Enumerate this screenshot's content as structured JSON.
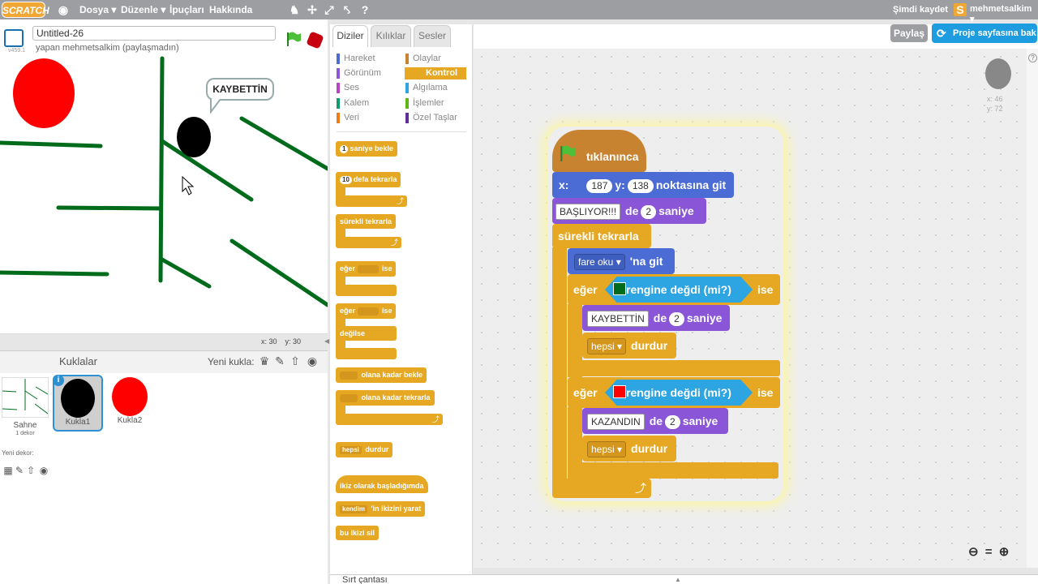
{
  "menu": {
    "logo": "SCRATCH",
    "file": "Dosya ▾",
    "edit": "Düzenle ▾",
    "tips": "İpuçları",
    "about": "Hakkında",
    "save_now": "Şimdi kaydet",
    "username": "mehmetsalkim ▾"
  },
  "header": {
    "project_title": "Untitled-26",
    "author": "yapan mehmetsalkim (paylaşmadın)",
    "version": "v459.1",
    "share_label": "Paylaş",
    "project_page_label": "Proje sayfasına bak"
  },
  "stage": {
    "speech": "KAYBETTİN",
    "x_label": "x: 30",
    "y_label": "y: 30"
  },
  "sprites": {
    "label": "Kuklalar",
    "new_sprite": "Yeni kukla:",
    "stage_label": "Sahne",
    "stage_dekor": "1 dekor",
    "new_dekor": "Yeni dekor:",
    "items": [
      {
        "name": "Kukla1",
        "color": "#000000"
      },
      {
        "name": "Kukla2",
        "color": "#ff0000"
      }
    ]
  },
  "tabs": [
    "Diziler",
    "Kılıklar",
    "Sesler"
  ],
  "categories": {
    "left": [
      {
        "label": "Hareket",
        "color": "#4a6cd4"
      },
      {
        "label": "Görünüm",
        "color": "#8a55d7"
      },
      {
        "label": "Ses",
        "color": "#bb42c3"
      },
      {
        "label": "Kalem",
        "color": "#0e9a6c"
      },
      {
        "label": "Veri",
        "color": "#ee7d16"
      }
    ],
    "right": [
      {
        "label": "Olaylar",
        "color": "#c88330"
      },
      {
        "label": "Kontrol",
        "color": "#e6a822"
      },
      {
        "label": "Algılama",
        "color": "#2ca5e2"
      },
      {
        "label": "İşlemler",
        "color": "#5cb712"
      },
      {
        "label": "Özel Taşlar",
        "color": "#632d99"
      }
    ]
  },
  "palette": {
    "wait_num": "1",
    "wait": "saniye bekle",
    "repeat_num": "10",
    "repeat": "defa tekrarla",
    "forever": "sürekli tekrarla",
    "if": "eğer",
    "then": "ise",
    "if2": "eğer",
    "then2": "ise",
    "else": "değilse",
    "wait_until": "olana kadar bekle",
    "repeat_until": "olana kadar tekrarla",
    "stop_opt": "hepsi",
    "stop": "durdur",
    "clone_start": "ikiz olarak başladığımda",
    "clone_opt": "kendim",
    "clone_create": "'in ikizini yarat",
    "clone_delete": "bu ikizi sil"
  },
  "script": {
    "hat": "tıklanınca",
    "goto_x_label": "x:",
    "goto_x": "187",
    "goto_y_label": "y:",
    "goto_y": "138",
    "goto_suffix": "noktasına git",
    "say1_text": "BAŞLIYOR!!!",
    "say1_de": "de",
    "say1_secs": "2",
    "say1_suffix": "saniye",
    "forever": "sürekli tekrarla",
    "point_opt": "fare oku",
    "point_suffix": "'na git",
    "if1": "eğer",
    "touch1": "rengine değdi (mi?)",
    "touch1_color": "#006b1b",
    "then1": "ise",
    "say2_text": "KAYBETTİN",
    "say2_de": "de",
    "say2_secs": "2",
    "say2_suffix": "saniye",
    "stop1_opt": "hepsi",
    "stop1": "durdur",
    "if2": "eğer",
    "touch2": "rengine değdi (mi?)",
    "touch2_color": "#ff0000",
    "then2": "ise",
    "say3_text": "KAZANDIN",
    "say3_de": "de",
    "say3_secs": "2",
    "say3_suffix": "saniye",
    "stop2_opt": "hepsi",
    "stop2": "durdur"
  },
  "sprite_info": {
    "x": "x: 46",
    "y": "y: 72"
  },
  "backpack": "Sırt çantası",
  "colors": {
    "control": "#e6a822",
    "motion": "#4a6cd4",
    "looks": "#8a55d7",
    "sensing": "#2ca5e2",
    "wall_green": "#006b1b",
    "menubar": "#9c9ea2"
  }
}
